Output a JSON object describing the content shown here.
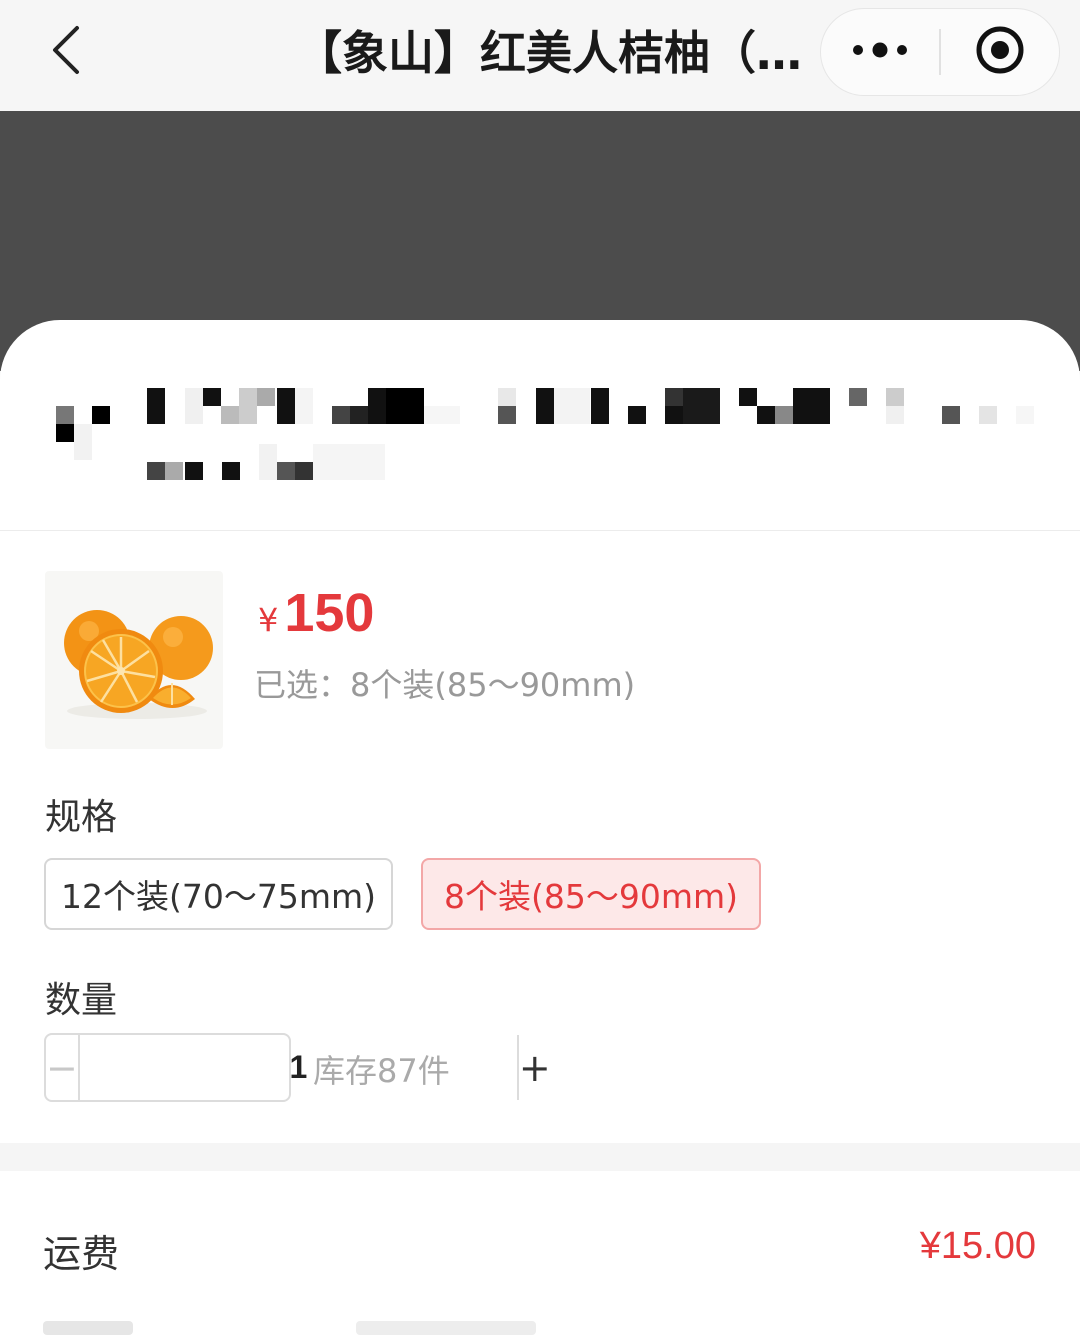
{
  "topbar": {
    "back_icon": "chevron-left-icon",
    "title": "【象山】红美人桔柚（…",
    "more_icon": "more-dots-icon",
    "close_icon": "target-circle-icon"
  },
  "address": {
    "content_state": "pixelated"
  },
  "product": {
    "currency_symbol": "¥",
    "price": "150",
    "selected_label": "已选：8个装(85～90mm)",
    "image_icon": "orange-fruit-image"
  },
  "spec": {
    "label": "规格",
    "options": [
      {
        "label": "12个装(70～75mm)",
        "selected": false
      },
      {
        "label": "8个装(85～90mm)",
        "selected": true
      }
    ]
  },
  "quantity": {
    "label": "数量",
    "value": "1",
    "minus": "−",
    "plus": "+",
    "stock": "库存87件"
  },
  "shipping": {
    "label": "运费",
    "value": "¥15.00"
  },
  "colors": {
    "accent": "#e4393c",
    "overlay": "#4c4c4c",
    "selected_bg": "#fde8e8"
  }
}
